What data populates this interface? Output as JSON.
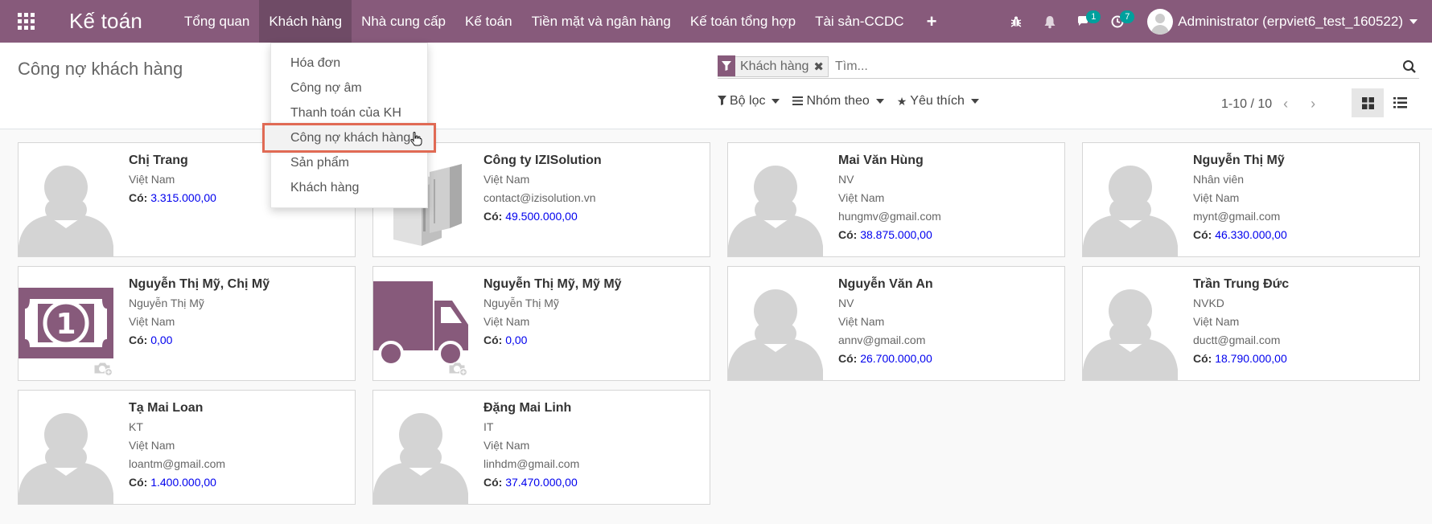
{
  "navbar": {
    "brand": "Kế toán",
    "menu": [
      "Tổng quan",
      "Khách hàng",
      "Nhà cung cấp",
      "Kế toán",
      "Tiền mặt và ngân hàng",
      "Kế toán tổng hợp",
      "Tài sản-CCDC"
    ],
    "plus": "+",
    "messages_count": "1",
    "activities_count": "7",
    "user": "Administrator (erpviet6_test_160522)"
  },
  "dropdown": {
    "items": [
      "Hóa đơn",
      "Công nợ âm",
      "Thanh toán của KH",
      "Công nợ khách hàng",
      "Sản phẩm",
      "Khách hàng"
    ]
  },
  "control": {
    "title": "Công nợ khách hàng",
    "facet": "Khách hàng",
    "search_placeholder": "Tìm...",
    "filter_label": "Bộ lọc",
    "groupby_label": "Nhóm theo",
    "favorites_label": "Yêu thích",
    "pager": "1-10 / 10"
  },
  "cards": [
    {
      "name": "Chị Trang",
      "lines": [
        "Việt Nam"
      ],
      "co_label": "Có:",
      "amount": "3.315.000,00",
      "img": "person"
    },
    {
      "name": "Công ty IZISolution",
      "lines": [
        "Việt Nam",
        "contact@izisolution.vn"
      ],
      "co_label": "Có:",
      "amount": "49.500.000,00",
      "img": "building"
    },
    {
      "name": "Mai Văn Hùng",
      "lines": [
        "NV",
        "Việt Nam",
        "hungmv@gmail.com"
      ],
      "co_label": "Có:",
      "amount": "38.875.000,00",
      "img": "person"
    },
    {
      "name": "Nguyễn Thị Mỹ",
      "lines": [
        "Nhân viên",
        "Việt Nam",
        "mynt@gmail.com"
      ],
      "co_label": "Có:",
      "amount": "46.330.000,00",
      "img": "person"
    },
    {
      "name": "Nguyễn Thị Mỹ, Chị Mỹ",
      "lines": [
        "Nguyễn Thị Mỹ",
        "Việt Nam"
      ],
      "co_label": "Có:",
      "amount": "0,00",
      "img": "money"
    },
    {
      "name": "Nguyễn Thị Mỹ, Mỹ Mỹ",
      "lines": [
        "Nguyễn Thị Mỹ",
        "Việt Nam"
      ],
      "co_label": "Có:",
      "amount": "0,00",
      "img": "truck"
    },
    {
      "name": "Nguyễn Văn An",
      "lines": [
        "NV",
        "Việt Nam",
        "annv@gmail.com"
      ],
      "co_label": "Có:",
      "amount": "26.700.000,00",
      "img": "person"
    },
    {
      "name": "Trần Trung Đức",
      "lines": [
        "NVKD",
        "Việt Nam",
        "ductt@gmail.com"
      ],
      "co_label": "Có:",
      "amount": "18.790.000,00",
      "img": "person"
    },
    {
      "name": "Tạ Mai Loan",
      "lines": [
        "KT",
        "Việt Nam",
        "loantm@gmail.com"
      ],
      "co_label": "Có:",
      "amount": "1.400.000,00",
      "img": "person"
    },
    {
      "name": "Đặng Mai Linh",
      "lines": [
        "IT",
        "Việt Nam",
        "linhdm@gmail.com"
      ],
      "co_label": "Có:",
      "amount": "37.470.000,00",
      "img": "person"
    }
  ]
}
